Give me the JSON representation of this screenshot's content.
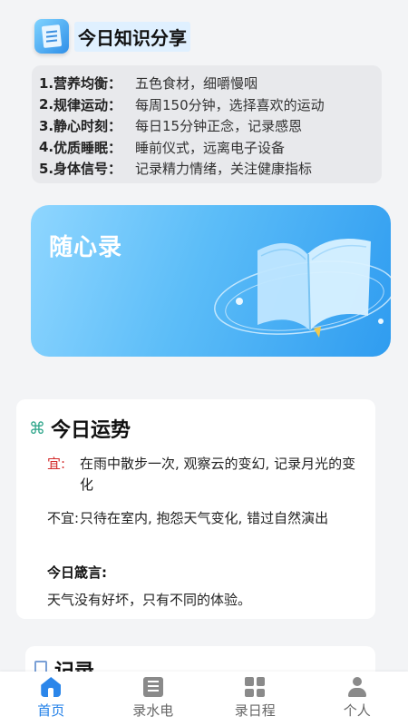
{
  "header": {
    "title": "今日知识分享"
  },
  "tips": [
    {
      "num": "1.",
      "label": "营养均衡：",
      "text": "五色食材，细嚼慢咽"
    },
    {
      "num": "2.",
      "label": "规律运动：",
      "text": "每周150分钟，选择喜欢的运动"
    },
    {
      "num": "3.",
      "label": "静心时刻：",
      "text": "每日15分钟正念，记录感恩"
    },
    {
      "num": "4.",
      "label": "优质睡眠：",
      "text": "睡前仪式，远离电子设备"
    },
    {
      "num": "5.",
      "label": "身体信号：",
      "text": "记录精力情绪，关注健康指标"
    }
  ],
  "banner": {
    "title": "随心录"
  },
  "fortune": {
    "title": "今日运势",
    "yi_label": "宜:",
    "yi_text": "在雨中散步一次, 观察云的变幻, 记录月光的变化",
    "buyi_label": "不宜:",
    "buyi_text": "只待在室内, 抱怨天气变化, 错过自然演出",
    "motto_label": "今日箴言:",
    "motto_text": "天气没有好坏，只有不同的体验。"
  },
  "next_card": {
    "title": "记录"
  },
  "tabs": [
    {
      "label": "首页",
      "icon": "home-icon"
    },
    {
      "label": "录水电",
      "icon": "meter-icon"
    },
    {
      "label": "录日程",
      "icon": "grid-icon"
    },
    {
      "label": "个人",
      "icon": "user-icon"
    }
  ],
  "colors": {
    "accent": "#1f7fe8",
    "yi": "#d32b2b",
    "banner_start": "#8fd6ff",
    "banner_end": "#2f9cf0"
  }
}
